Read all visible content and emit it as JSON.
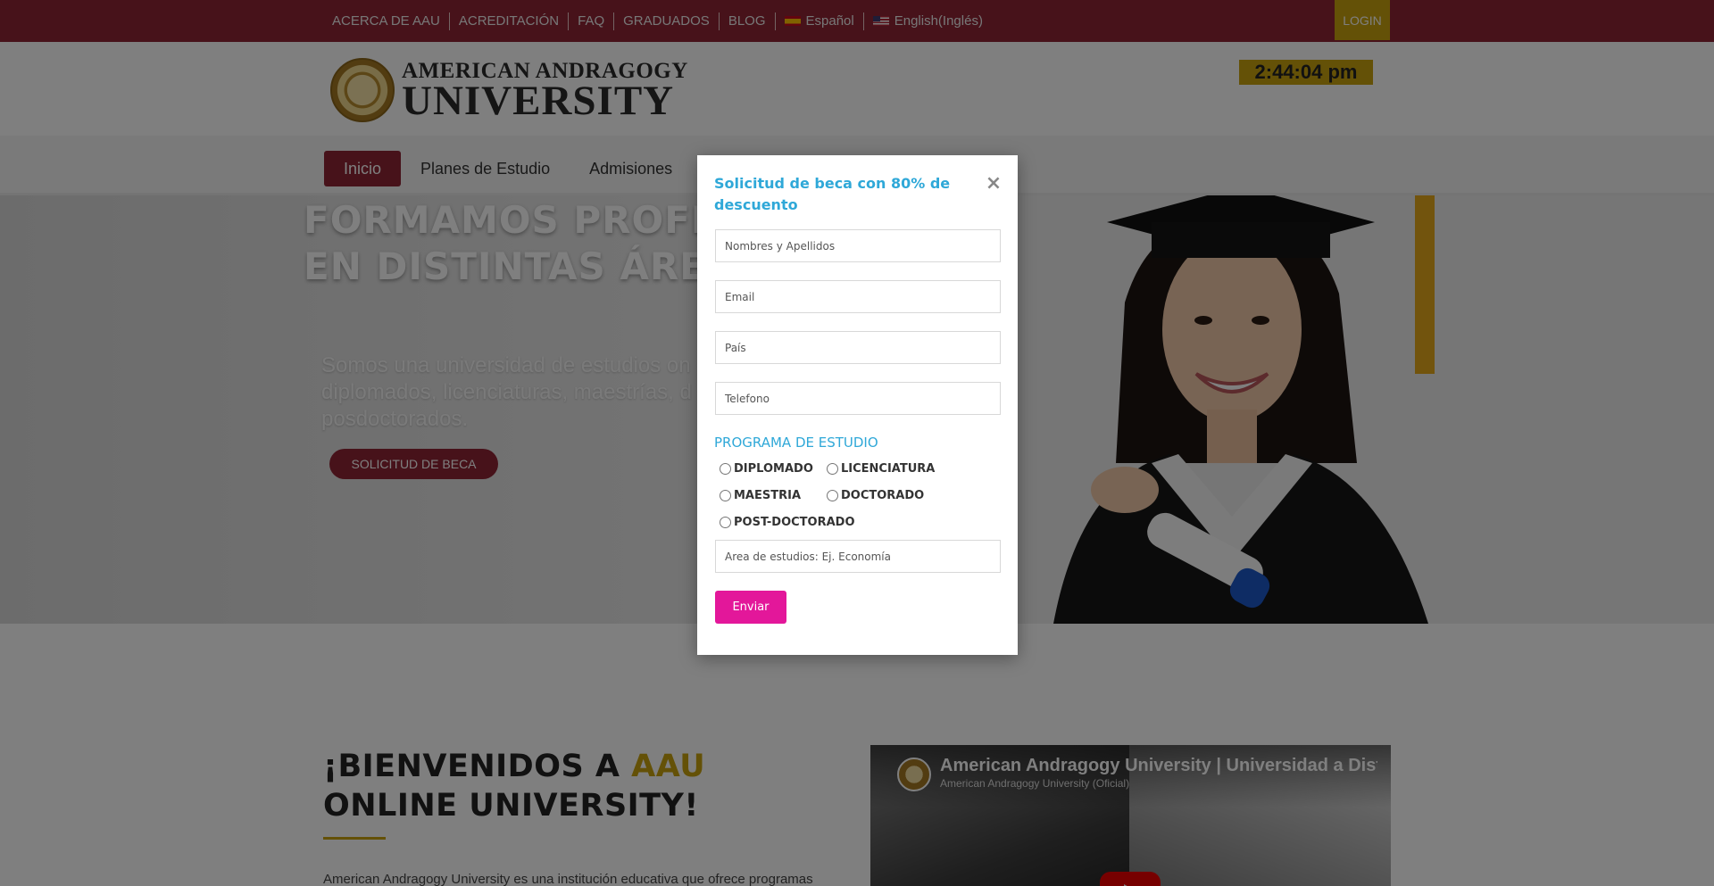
{
  "topbar": {
    "links": [
      "ACERCA DE AAU",
      "ACREDITACIÓN",
      "FAQ",
      "GRADUADOS",
      "BLOG"
    ],
    "lang_es": "Español",
    "lang_en": "English(Inglés)",
    "login": "LOGIN"
  },
  "header": {
    "logo_line1": "AMERICAN ANDRAGOGY",
    "logo_line2": "UNIVERSITY",
    "clock": "2:44:04 pm"
  },
  "nav": {
    "items": [
      "Inicio",
      "Planes de Estudio",
      "Admisiones"
    ]
  },
  "hero": {
    "title_line1": "FORMAMOS PROFES",
    "title_line2": "EN DISTINTAS ÁREA",
    "text": "Somos una universidad de estudios on diplomados, licenciaturas, maestrías, d posdoctorados.",
    "button": "SOLICITUD DE BECA"
  },
  "welcome": {
    "title_part1": "¡BIENVENIDOS A ",
    "title_gold": "AAU",
    "title_line2": "ONLINE UNIVERSITY!",
    "text": "American Andragogy University es una institución educativa que ofrece programas"
  },
  "video": {
    "title": "American Andragogy University | Universidad a Dista",
    "channel": "American Andragogy University (Oficial)"
  },
  "modal": {
    "title": "Solicitud de beca con 80% de descuento",
    "close": "×",
    "fields": {
      "name": "Nombres y Apellidos",
      "email": "Email",
      "country": "País",
      "phone": "Telefono",
      "area": "Area de estudios: Ej. Economía"
    },
    "program_title": "PROGRAMA DE ESTUDIO",
    "programs": [
      "DIPLOMADO",
      "LICENCIATURA",
      "MAESTRIA",
      "DOCTORADO",
      "POST-DOCTORADO"
    ],
    "submit": "Enviar"
  },
  "colors": {
    "brand": "#8e2535",
    "gold": "#c9a20f",
    "modal_accent": "#2fa8d8",
    "submit": "#e3179a"
  }
}
